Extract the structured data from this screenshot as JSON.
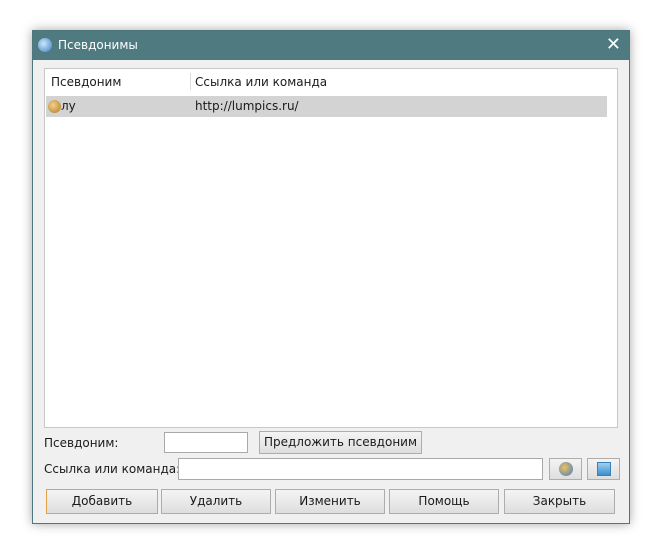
{
  "window": {
    "title": "Псевдонимы",
    "close": "✕"
  },
  "list": {
    "columns": [
      "Псевдоним",
      "Ссылка или команда"
    ],
    "rows": [
      {
        "alias": "лу",
        "link": "http://lumpics.ru/"
      }
    ]
  },
  "form": {
    "alias_label": "Псевдоним:",
    "alias_value": "",
    "suggest_button": "Предложить псевдоним",
    "link_label": "Ссылка или команда:",
    "link_value": ""
  },
  "buttons": {
    "add": "Добавить",
    "delete": "Удалить",
    "edit": "Изменить",
    "help": "Помощь",
    "close": "Закрыть"
  }
}
